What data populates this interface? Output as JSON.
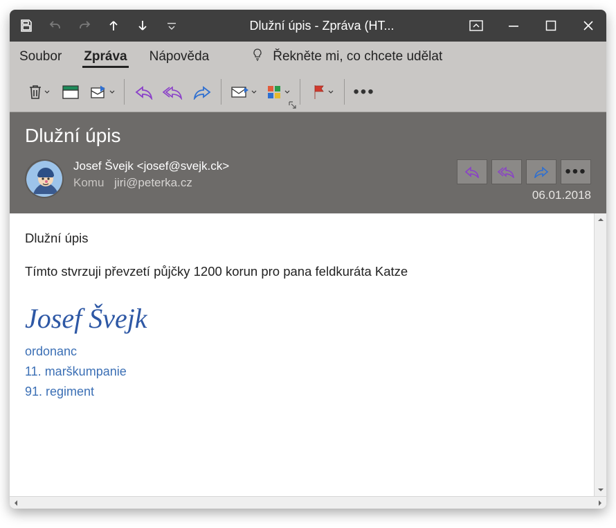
{
  "titlebar": {
    "title": "Dlužní úpis  -  Zpráva (HT..."
  },
  "menu": {
    "file": "Soubor",
    "message": "Zpráva",
    "help": "Nápověda",
    "tellme": "Řekněte mi, co chcete udělat"
  },
  "header": {
    "subject": "Dlužní úpis",
    "sender": "Josef Švejk  <josef@svejk.ck>",
    "to_label": "Komu",
    "to_value": "jiri@peterka.cz",
    "date": "06.01.2018"
  },
  "body": {
    "subject_line": "Dlužní  úpis",
    "text": "Tímto stvrzuji převzetí půjčky 1200 korun pro pana feldkuráta Katze",
    "sig_name": "Josef Švejk",
    "sig_line1": "ordonanc",
    "sig_line2": "11. marškumpanie",
    "sig_line3": "91. regiment"
  }
}
